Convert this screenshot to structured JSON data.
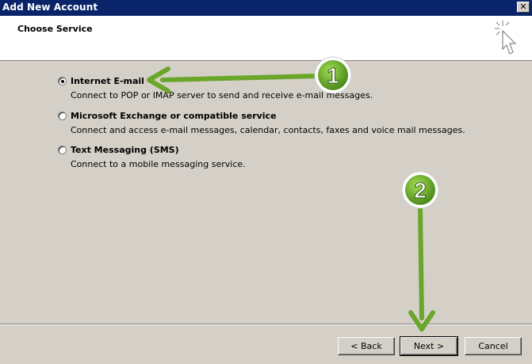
{
  "window": {
    "title": "Add New Account",
    "close_glyph": "✕"
  },
  "header": {
    "title": "Choose Service",
    "icon": "wizard-cursor-icon"
  },
  "options": [
    {
      "label": "Internet E-mail",
      "description": "Connect to POP or IMAP server to send and receive e-mail messages.",
      "selected": true
    },
    {
      "label": "Microsoft Exchange or compatible service",
      "description": "Connect and access e-mail messages, calendar, contacts, faxes and voice mail messages.",
      "selected": false
    },
    {
      "label": "Text Messaging (SMS)",
      "description": "Connect to a mobile messaging service.",
      "selected": false
    }
  ],
  "buttons": {
    "back": "< Back",
    "next": "Next >",
    "cancel": "Cancel"
  },
  "annotations": {
    "step1": "1",
    "step2": "2",
    "color": "#6aa629"
  }
}
